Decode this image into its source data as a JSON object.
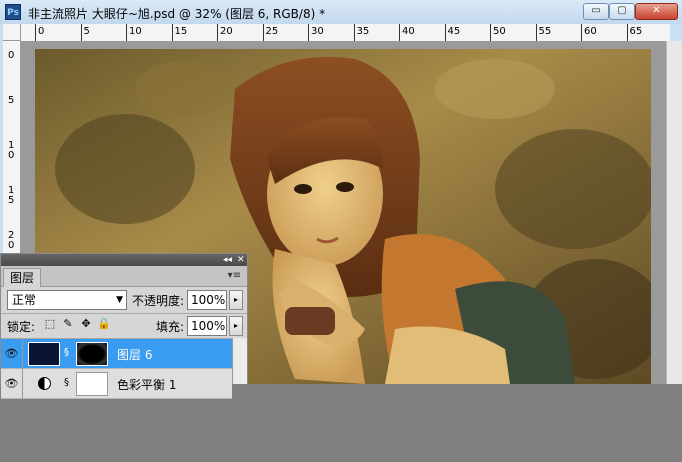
{
  "window": {
    "title": "非主流照片 大眼仔~旭.psd @ 32% (图层 6, RGB/8) *",
    "app_icon": "Ps",
    "controls": {
      "minimize": "▭",
      "restore": "▢",
      "close": "✕"
    }
  },
  "ruler": {
    "h_labels": [
      "0",
      "5",
      "10",
      "15",
      "20",
      "25",
      "30",
      "35",
      "40",
      "45",
      "50",
      "55",
      "60",
      "65"
    ],
    "v_labels": [
      "0",
      "5",
      "10",
      "15",
      "20"
    ]
  },
  "layers_panel": {
    "bar_left": "◂◂",
    "bar_right": "✕",
    "tab": "图层",
    "menu_icon": "▾≡",
    "blend_mode": "正常",
    "opacity_label": "不透明度:",
    "opacity_value": "100%",
    "lock_label": "锁定:",
    "fill_label": "填充:",
    "fill_value": "100%",
    "layers": [
      {
        "name": "图层 6",
        "selected": true
      },
      {
        "name": "色彩平衡 1",
        "selected": false
      }
    ]
  },
  "colors": {
    "selection": "#3a9cf0",
    "photo_tone": "#c8a25a"
  }
}
